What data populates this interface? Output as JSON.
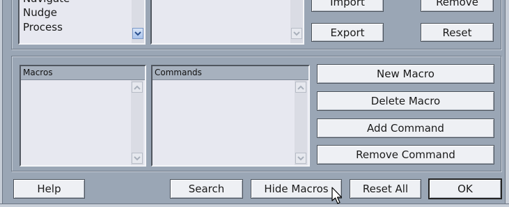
{
  "top": {
    "categories_list": {
      "items": [
        "Navigate",
        "Nudge",
        "Process"
      ]
    },
    "buttons": {
      "import": "Import",
      "remove": "Remove",
      "export": "Export",
      "reset": "Reset"
    }
  },
  "macros": {
    "macros_header": "Macros",
    "commands_header": "Commands",
    "buttons": {
      "new_macro": "New Macro",
      "delete_macro": "Delete Macro",
      "add_command": "Add Command",
      "remove_command": "Remove Command"
    }
  },
  "footer": {
    "help": "Help",
    "search": "Search",
    "hide_macros": "Hide Macros",
    "reset_all": "Reset All",
    "ok": "OK"
  },
  "icons": {
    "scroll_up": "chevron-up-icon",
    "scroll_down": "chevron-down-icon",
    "cursor": "mouse-pointer-icon"
  },
  "colors": {
    "dialog_background": "#9aa6b5",
    "list_background": "#e7e8f0",
    "list_header": "#a7b1be",
    "button_face": "#eef0f4",
    "scroll_arrow_blue": "#a9c3ec"
  }
}
